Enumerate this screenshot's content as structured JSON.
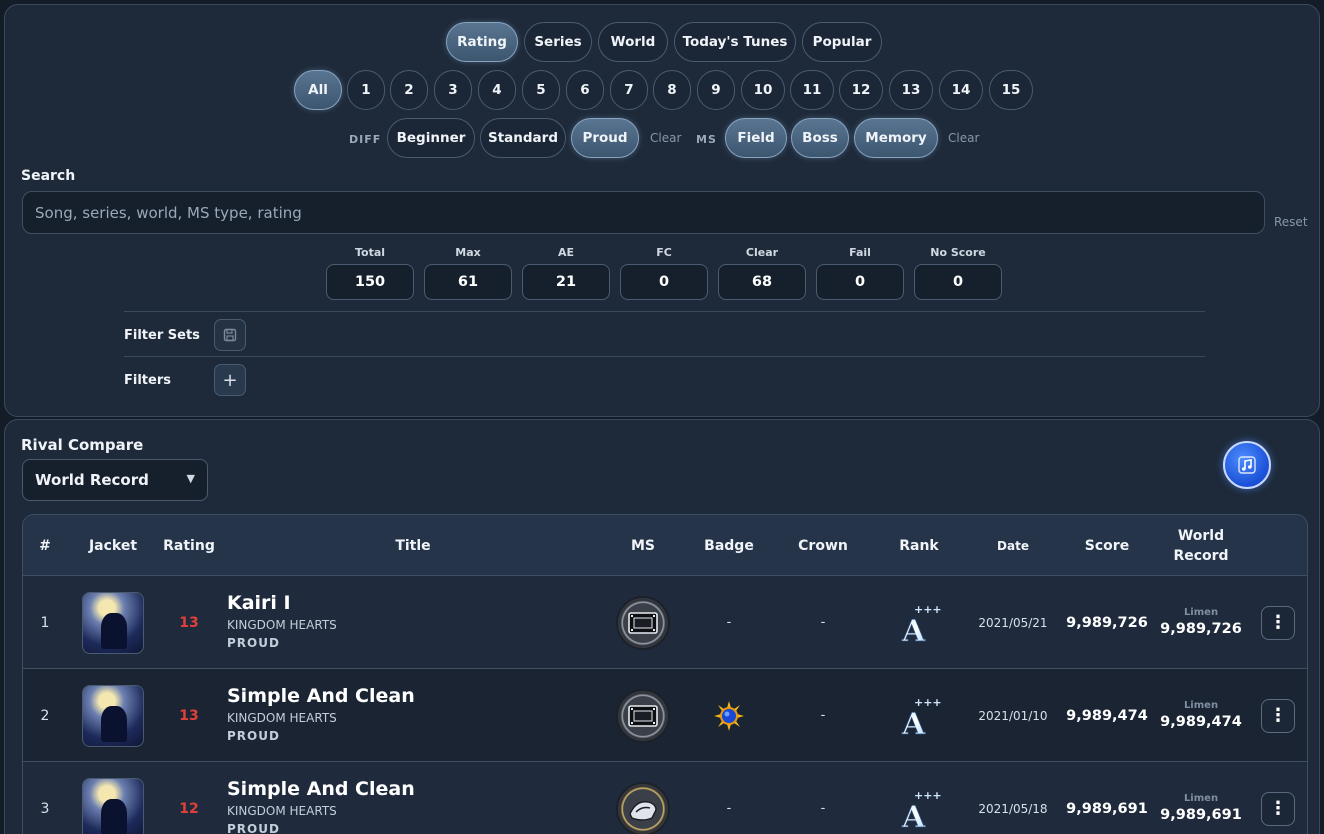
{
  "sort_tabs": [
    "Rating",
    "Series",
    "World",
    "Today's Tunes",
    "Popular"
  ],
  "sort_active": "Rating",
  "levels": [
    "All",
    "1",
    "2",
    "3",
    "4",
    "5",
    "6",
    "7",
    "8",
    "9",
    "10",
    "11",
    "12",
    "13",
    "14",
    "15"
  ],
  "level_active": "All",
  "diff": {
    "label": "DIFF",
    "options": [
      "Beginner",
      "Standard",
      "Proud"
    ],
    "active": [
      "Proud"
    ],
    "clear": "Clear"
  },
  "ms": {
    "label": "MS",
    "options": [
      "Field",
      "Boss",
      "Memory"
    ],
    "active": [
      "Field",
      "Boss",
      "Memory"
    ],
    "clear": "Clear"
  },
  "search": {
    "label": "Search",
    "placeholder": "Song, series, world, MS type, rating",
    "value": "",
    "reset": "Reset"
  },
  "stats": [
    {
      "label": "Total",
      "value": "150"
    },
    {
      "label": "Max",
      "value": "61"
    },
    {
      "label": "AE",
      "value": "21"
    },
    {
      "label": "FC",
      "value": "0"
    },
    {
      "label": "Clear",
      "value": "68"
    },
    {
      "label": "Fail",
      "value": "0"
    },
    {
      "label": "No Score",
      "value": "0"
    }
  ],
  "filter_sets": {
    "label": "Filter Sets",
    "icon": "save-icon"
  },
  "filters": {
    "label": "Filters",
    "icon": "plus-icon",
    "symbol": "+"
  },
  "rival": {
    "label": "Rival Compare",
    "selected": "World Record",
    "fab_icon": "music-note-icon"
  },
  "table": {
    "headers": [
      "#",
      "Jacket",
      "Rating",
      "Title",
      "MS",
      "Badge",
      "Crown",
      "Rank",
      "Date",
      "Score",
      "World Record"
    ],
    "rows": [
      {
        "index": "1",
        "rating": "13",
        "title": "Kairi I",
        "series": "KINGDOM HEARTS",
        "difficulty": "PROUD",
        "ms_icon": "film-icon",
        "badge": "-",
        "crown": "-",
        "rank": "A+++",
        "date": "2021/05/21",
        "score": "9,989,726",
        "wr_holder": "Limen",
        "wr_score": "9,989,726"
      },
      {
        "index": "2",
        "rating": "13",
        "title": "Simple And Clean",
        "series": "KINGDOM HEARTS",
        "difficulty": "PROUD",
        "ms_icon": "film-icon",
        "badge": "sun-badge-icon",
        "crown": "-",
        "rank": "A+++",
        "date": "2021/01/10",
        "score": "9,989,474",
        "wr_holder": "Limen",
        "wr_score": "9,989,474"
      },
      {
        "index": "3",
        "rating": "12",
        "title": "Simple And Clean",
        "series": "KINGDOM HEARTS",
        "difficulty": "PROUD",
        "ms_icon": "boss-icon",
        "badge": "-",
        "crown": "-",
        "rank": "A+++",
        "date": "2021/05/18",
        "score": "9,989,691",
        "wr_holder": "Limen",
        "wr_score": "9,989,691"
      }
    ]
  },
  "colors": {
    "background": "#141c27",
    "panel": "#1e2a3a",
    "accent_active": "#4a6580",
    "rating_red": "#e0403a",
    "fab_blue": "#2a64f0"
  }
}
